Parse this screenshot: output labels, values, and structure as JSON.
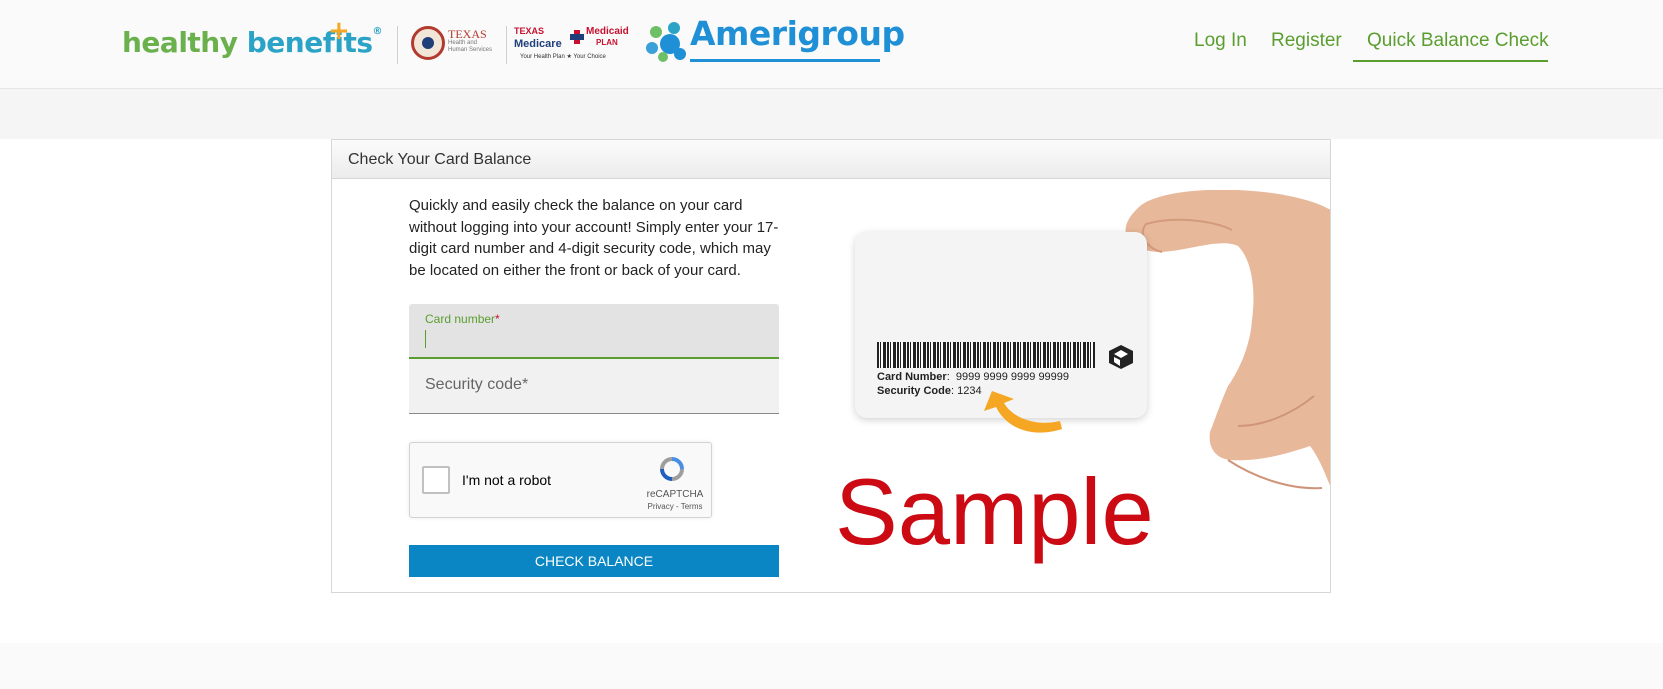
{
  "header": {
    "logo_healthy": "healthy",
    "logo_benefits": "benefits",
    "logo_registered": "®",
    "texas_logo": {
      "title": "TEXAS",
      "subtitle": "Health and Human Services"
    },
    "medicare_logo": {
      "line1_left": "TEXAS",
      "line1_right": "Medicaid",
      "line2_left": "Medicare",
      "line2_right": "PLAN",
      "tagline": "Your Health Plan ★ Your Choice"
    },
    "amerigroup": "Amerigroup",
    "nav": {
      "login": "Log In",
      "register": "Register",
      "quick_balance": "Quick Balance Check"
    }
  },
  "panel": {
    "title": "Check Your Card Balance",
    "description": "Quickly and easily check the balance on your card without logging into your account! Simply enter your 17-digit card number and 4-digit security code, which may be located on either the front or back of your card."
  },
  "form": {
    "card_number_label": "Card number",
    "card_number_value": "",
    "security_code_placeholder": "Security code",
    "required_mark": "*"
  },
  "captcha": {
    "label": "I'm not a robot",
    "brand": "reCAPTCHA",
    "links": "Privacy - Terms"
  },
  "button": {
    "check_balance": "CHECK BALANCE"
  },
  "sample_card": {
    "card_number_label": "Card Number",
    "card_number_value": "9999 9999 9999 99999",
    "security_code_label": "Security Code",
    "security_code_value": "1234",
    "watermark": "Sample"
  },
  "colors": {
    "brand_green": "#5a9e2f",
    "brand_blue": "#0a86c4",
    "amerigroup_blue": "#1f8fd6",
    "sample_red": "#cc0a14"
  }
}
